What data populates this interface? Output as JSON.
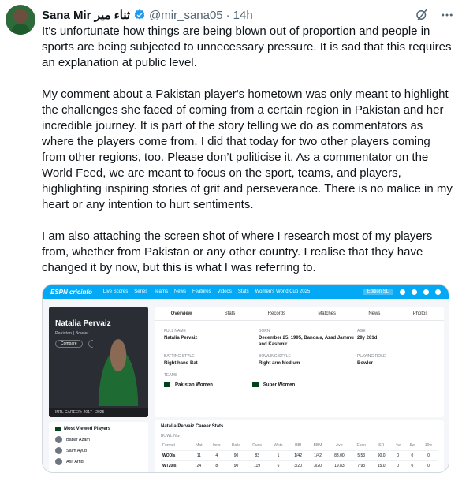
{
  "tweet": {
    "name": "Sana Mir",
    "name_urdu": "ثناء میر",
    "handle": "@mir_sana05",
    "time": "14h",
    "text": "It's unfortunate how things are being blown out of proportion and people in sports are being subjected to unnecessary pressure. It is sad that this requires an explanation at public level.\n\nMy comment about a Pakistan player's hometown was only meant to highlight the challenges she faced of coming from a certain region in Pakistan and her incredible journey. It is part of the story telling we do as commentators as where the players come from. I did that today for two other players coming from other regions, too. Please don’t politicise it. As a commentator on the World Feed, we are meant to focus on the sport, teams, and players, highlighting inspiring stories of grit and perseverance. There is no malice in my heart or any intention to hurt sentiments.\n\nI am also attaching the screen shot of where I research most of my players from, whether from Pakistan or any other country. I realise that they have changed it by now, but this is what I was referring to."
  },
  "colors": {
    "verified": "#1d9bf0",
    "cricinfo_blue": "#03a9f4"
  },
  "icons": {
    "verified": "verified-badge-icon",
    "grok": "grok-icon",
    "more": "more-icon"
  },
  "shot": {
    "logo": "ESPN cricinfo",
    "nav": [
      "Live Scores",
      "Series",
      "Teams",
      "News",
      "Features",
      "Videos",
      "Stats",
      "Women's World Cup 2025"
    ],
    "edition": "Edition SL",
    "player_name": "Natalia Pervaiz",
    "player_role": "Pakistan | Bowler",
    "compare": "Compare",
    "career": "INTL CAREER: 2017 - 2025",
    "most_viewed": "Most Viewed Players",
    "most_viewed_list": [
      "Babar Azam",
      "Saim Ayub",
      "Asif Afridi"
    ],
    "tabs": [
      "Overview",
      "Stats",
      "Records",
      "Matches",
      "News",
      "Photos"
    ],
    "info": {
      "full_name_label": "FULL NAME",
      "full_name": "Natalia Pervaiz",
      "born_label": "BORN",
      "born": "December 25, 1995, Bandala, Azad Jammu and Kashmir",
      "age_label": "AGE",
      "age": "29y 281d",
      "batting_label": "BATTING STYLE",
      "batting": "Right hand Bat",
      "bowling_label": "BOWLING STYLE",
      "bowling": "Right arm Medium",
      "role_label": "PLAYING ROLE",
      "role": "Bowler"
    },
    "teams_label": "TEAMS",
    "teams": [
      "Pakistan Women",
      "Super Women"
    ],
    "stats_title": "Natalia Pervaiz Career Stats",
    "stats_sub": "BOWLING",
    "stats_header": [
      "Format",
      "Mat",
      "Inns",
      "Balls",
      "Runs",
      "Wkts",
      "BBI",
      "BBM",
      "Ave",
      "Econ",
      "SR",
      "4w",
      "5w",
      "10w"
    ],
    "stats_rows": [
      [
        "WODIs",
        "11",
        "4",
        "90",
        "83",
        "1",
        "1/42",
        "1/42",
        "83.00",
        "5.53",
        "90.0",
        "0",
        "0",
        "0"
      ],
      [
        "WT20Is",
        "24",
        "8",
        "90",
        "119",
        "6",
        "3/20",
        "3/20",
        "19.83",
        "7.93",
        "15.0",
        "0",
        "0",
        "0"
      ]
    ]
  }
}
